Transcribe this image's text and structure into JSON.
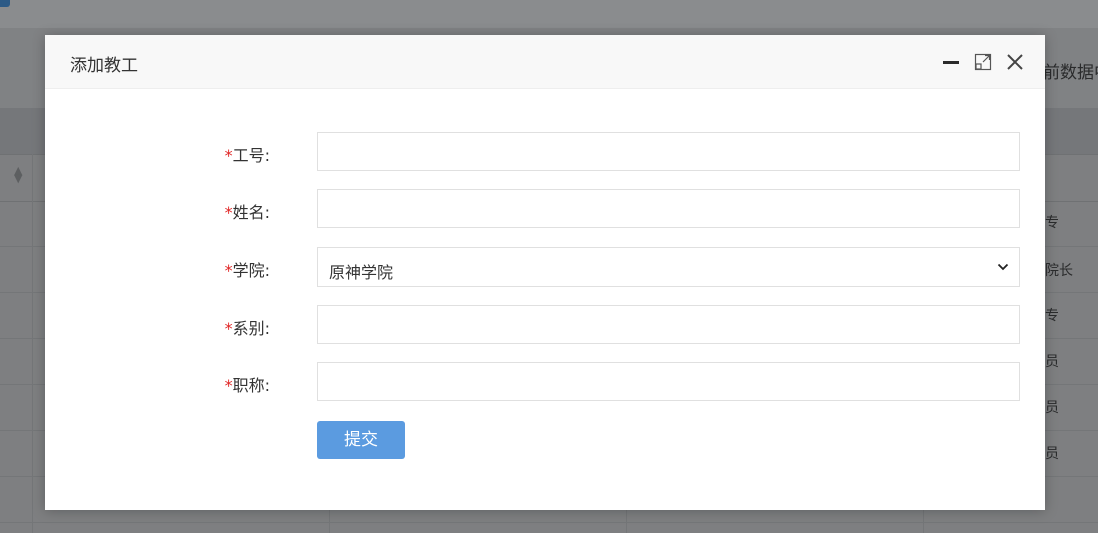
{
  "background": {
    "toolbar_text": "前数据中",
    "cells": [
      "专",
      "院长",
      "专",
      "员",
      "员",
      "员"
    ]
  },
  "modal": {
    "title": "添加教工",
    "fields": [
      {
        "required_mark": "*",
        "label": "工号:",
        "value": "",
        "placeholder": ""
      },
      {
        "required_mark": "*",
        "label": "姓名:",
        "value": "",
        "placeholder": ""
      },
      {
        "required_mark": "*",
        "label": "学院:",
        "selected": "原神学院",
        "type": "select"
      },
      {
        "required_mark": "*",
        "label": "系别:",
        "value": "",
        "placeholder": ""
      },
      {
        "required_mark": "*",
        "label": "职称:",
        "value": "",
        "placeholder": ""
      }
    ],
    "submit_label": "提交",
    "header_icons": [
      "minimize-icon",
      "maximize-icon",
      "close-icon"
    ]
  },
  "colors": {
    "required": "#e02424",
    "submit_bg": "#5b9be0",
    "header_bg": "#f8f8f8"
  }
}
